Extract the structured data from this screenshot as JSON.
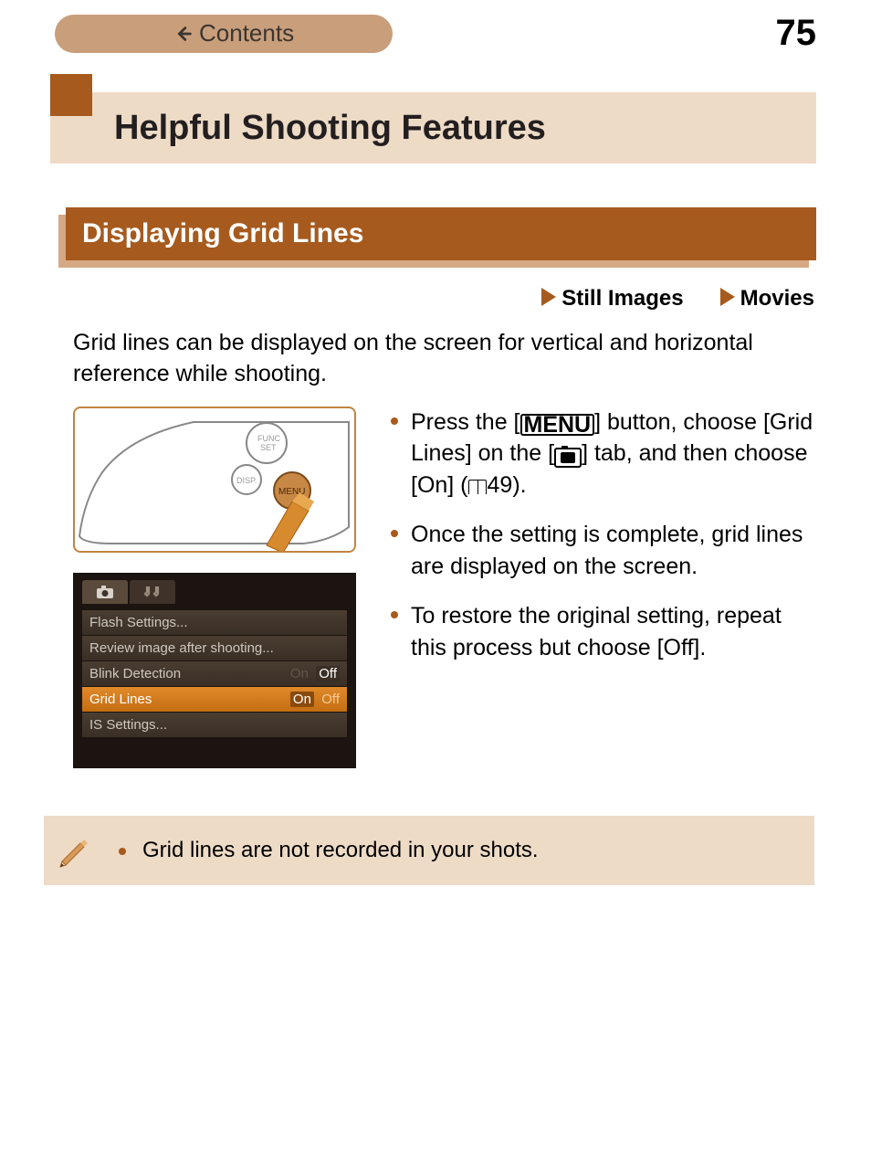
{
  "page_number": "75",
  "contents_label": "Contents",
  "section_title": "Helpful Shooting Features",
  "subsection_title": "Displaying Grid Lines",
  "mode_still": "Still Images",
  "mode_movies": "Movies",
  "intro_text": "Grid lines can be displayed on the screen for vertical and horizontal reference while shooting.",
  "menu_icon_text": "MENU",
  "page_ref": "49",
  "bullet1_a": "Press the [",
  "bullet1_b": "] button, choose [Grid Lines] on the [",
  "bullet1_c": "] tab, and then choose [On] (",
  "bullet1_d": ").",
  "bullet2": "Once the setting is complete, grid lines are displayed on the screen.",
  "bullet3": "To restore the original setting, repeat this process but choose [Off].",
  "note1": "Grid lines are not recorded in your shots.",
  "lcd": {
    "row1": "Flash Settings...",
    "row2": "Review image after shooting...",
    "row3_label": "Blink Detection",
    "row3_on": "On",
    "row3_off": "Off",
    "row4_label": "Grid Lines",
    "row4_on": "On",
    "row4_off": "Off",
    "row5": "IS Settings..."
  }
}
